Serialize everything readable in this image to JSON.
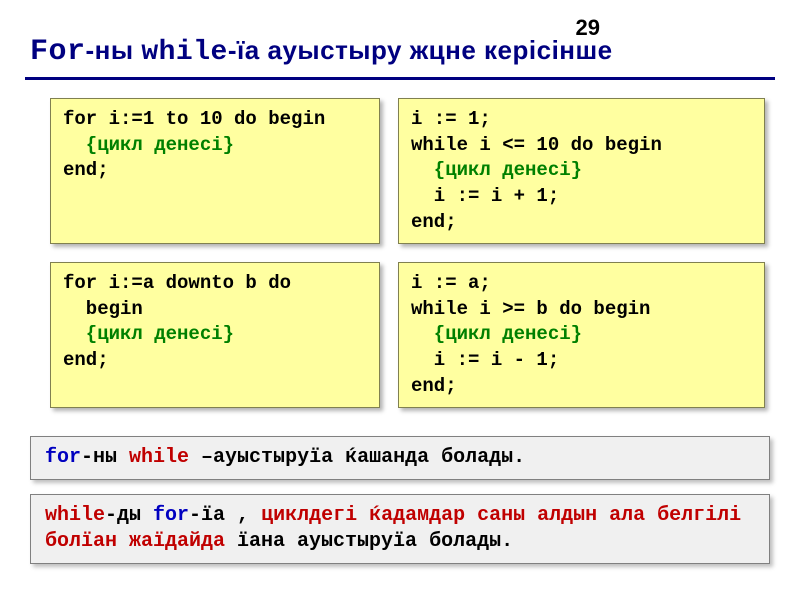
{
  "page_number": "29",
  "title": {
    "for": "For",
    "mid1": "-ны ",
    "while": "while",
    "rest": "-їа ауыстыру жцне керісінше"
  },
  "code": {
    "for_to": {
      "l1": "for i:=1 to 10 do begin",
      "l2": "  {цикл денесі}",
      "l3": "end;"
    },
    "while_up": {
      "l1": "i := 1;",
      "l2": "while i <= 10 do begin",
      "l3": "  {цикл денесі}",
      "l4": "  i := i + 1;",
      "l5": "end;"
    },
    "for_downto": {
      "l1": "for i:=a downto b do",
      "l2": "  begin",
      "l3": "  {цикл денесі}",
      "l4": "end;"
    },
    "while_down": {
      "l1": "i := a;",
      "l2": "while i >= b do begin",
      "l3": "  {цикл денесі}",
      "l4": "  i := i - 1;",
      "l5": "end;"
    }
  },
  "rule1": {
    "for": "for",
    "mid": "-ны ",
    "while": "while",
    "rest": " –ауыстыруїа ќашанда болады."
  },
  "rule2": {
    "while": "while",
    "mid1": "-ды ",
    "for": "for",
    "mid2": "-їа , ",
    "hl": "циклдегі ќадамдар саны алдын ала белгілі болїан жаїдайда ",
    "rest": "їана ауыстыруїа болады."
  }
}
